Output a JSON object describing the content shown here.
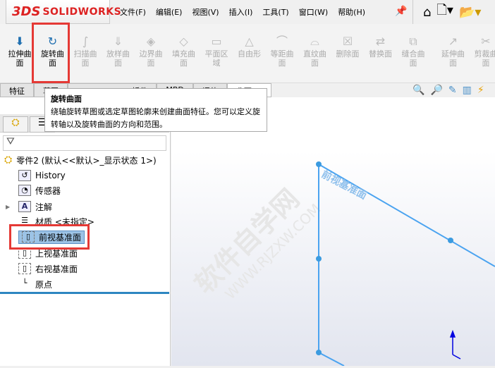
{
  "app": {
    "logo": "SOLIDWORKS",
    "logo_mark": "3DS"
  },
  "menu": [
    "文件(F)",
    "编辑(E)",
    "视图(V)",
    "插入(I)",
    "工具(T)",
    "窗口(W)",
    "帮助(H)"
  ],
  "toolbar": [
    {
      "l1": "拉伸曲",
      "l2": "面",
      "on": true
    },
    {
      "l1": "旋转曲",
      "l2": "面",
      "on": true
    },
    {
      "l1": "扫描曲",
      "l2": "面"
    },
    {
      "l1": "放样曲",
      "l2": "面"
    },
    {
      "l1": "边界曲",
      "l2": "面"
    },
    {
      "l1": "填充曲",
      "l2": "面"
    },
    {
      "l1": "平面区",
      "l2": "域"
    },
    {
      "l1": "自由形",
      "l2": ""
    },
    {
      "l1": "等距曲",
      "l2": "面"
    },
    {
      "l1": "直纹曲",
      "l2": "面"
    },
    {
      "l1": "删除面",
      "l2": ""
    },
    {
      "l1": "替换面",
      "l2": ""
    },
    {
      "l1": "缝合曲",
      "l2": "面"
    },
    {
      "l1": "延伸曲",
      "l2": "面"
    },
    {
      "l1": "剪裁曲",
      "l2": "面"
    }
  ],
  "tabs": [
    "特征",
    "草图",
    "SOLIDWORKS 插件",
    "MBD",
    "评估",
    "曲面(E)"
  ],
  "tooltip": {
    "title": "旋转曲面",
    "body": "绕轴旋转草图或选定草图轮廓来创建曲面特征。您可以定义旋转轴以及旋转曲面的方向和范围。"
  },
  "tree": {
    "root": "零件2  (默认<<默认>_显示状态 1>)",
    "items": [
      "History",
      "传感器",
      "注解",
      "材质 <未指定>",
      "前视基准面",
      "上视基准面",
      "右视基准面",
      "原点"
    ]
  },
  "viewport": {
    "plane_label": "前视基准面",
    "watermark": "软件自学网",
    "watermark_url": "WWW.RJZXW.COM"
  }
}
